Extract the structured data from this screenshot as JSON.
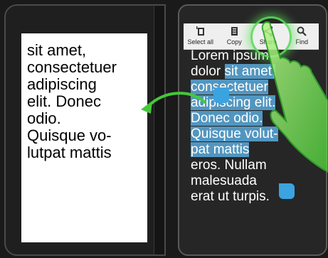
{
  "left_panel": {
    "lines": [
      "sit amet,",
      "consectetuer",
      "adipiscing",
      "elit. Donec",
      "odio.",
      "Quisque vo-",
      "lutpat mattis"
    ]
  },
  "context_toolbar": {
    "items": [
      {
        "icon": "select-all-icon",
        "label": "Select all"
      },
      {
        "icon": "copy-icon",
        "label": "Copy"
      },
      {
        "icon": "share-icon",
        "label": "Share"
      },
      {
        "icon": "search-icon",
        "label": "Find"
      }
    ]
  },
  "right_panel": {
    "lines": [
      {
        "plain": "Lorem ipsum",
        "sel": ""
      },
      {
        "plain": "dolor ",
        "sel": "sit amet,"
      },
      {
        "plain": "",
        "sel": "consectetuer"
      },
      {
        "plain": "",
        "sel": "adipiscing elit."
      },
      {
        "plain": "",
        "sel": "Donec odio."
      },
      {
        "plain": "",
        "sel": "Quisque volut-"
      },
      {
        "plain": "",
        "sel": "pat mattis"
      },
      {
        "plain": "eros. Nullam",
        "sel": ""
      },
      {
        "plain": "malesuada",
        "sel": ""
      },
      {
        "plain": "erat ut turpis.",
        "sel": ""
      }
    ]
  },
  "colors": {
    "selection": "#5aaadc",
    "accent_green": "#5adc5a",
    "handle_blue": "#3ba3e0"
  }
}
